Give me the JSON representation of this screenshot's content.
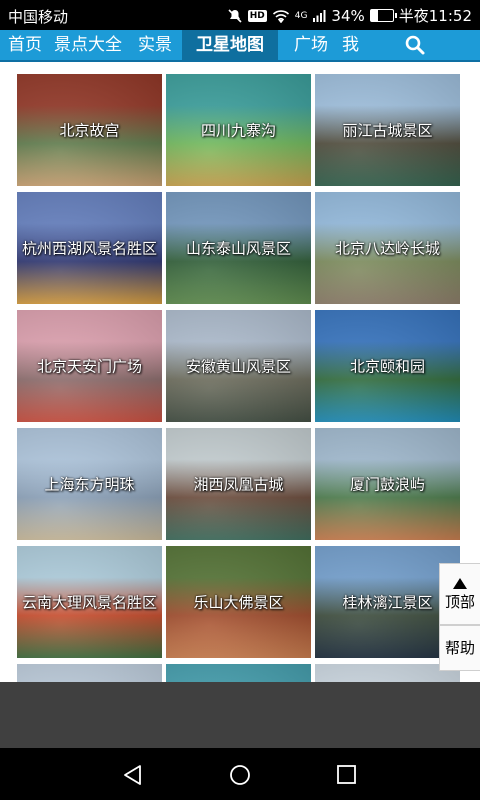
{
  "status_bar": {
    "carrier": "中国移动",
    "hd_badge": "HD",
    "network": "4G",
    "battery_percent": "34%",
    "battery_level": 0.34,
    "time": "半夜11:52"
  },
  "nav": {
    "items": [
      {
        "label": "首页"
      },
      {
        "label": "景点大全"
      },
      {
        "label": "实景"
      },
      {
        "label": "卫星地图",
        "active": true
      },
      {
        "label": "广场"
      },
      {
        "label": "我"
      }
    ],
    "accent_color": "#1d9bd7",
    "active_color": "#0f6f9f"
  },
  "grid": {
    "tiles": [
      {
        "label": "北京故宫",
        "colors": [
          "#9a3b2a",
          "#5d7a4a",
          "#c9a070"
        ]
      },
      {
        "label": "四川九寨沟",
        "colors": [
          "#3fa7a4",
          "#6fb85a",
          "#c7a04a"
        ]
      },
      {
        "label": "丽江古城景区",
        "colors": [
          "#a7c9e8",
          "#4e4a3a",
          "#2e5f4a"
        ]
      },
      {
        "label": "杭州西湖风景名胜区",
        "colors": [
          "#6a86c8",
          "#2c3470",
          "#d49a3a"
        ]
      },
      {
        "label": "山东泰山风景区",
        "colors": [
          "#7aa0c8",
          "#2e5d36",
          "#5b8a4a"
        ]
      },
      {
        "label": "北京八达岭长城",
        "colors": [
          "#9cc4e8",
          "#7a8a5a",
          "#8a7a66"
        ]
      },
      {
        "label": "北京天安门广场",
        "colors": [
          "#e8a9b8",
          "#8a6a6a",
          "#c84a3a"
        ]
      },
      {
        "label": "安徽黄山风景区",
        "colors": [
          "#b7c6d8",
          "#6a6a5a",
          "#3e4a3e"
        ]
      },
      {
        "label": "北京颐和园",
        "colors": [
          "#3a7ac8",
          "#2e6a3a",
          "#1a8ab8"
        ]
      },
      {
        "label": "上海东方明珠",
        "colors": [
          "#b8d0e8",
          "#8aa0b8",
          "#c8b898"
        ]
      },
      {
        "label": "湘西凤凰古城",
        "colors": [
          "#cfd9dc",
          "#6a4a3a",
          "#3a6a5a"
        ]
      },
      {
        "label": "厦门鼓浪屿",
        "colors": [
          "#aac4da",
          "#4a7a4a",
          "#c87a4a"
        ]
      },
      {
        "label": "云南大理风景名胜区",
        "colors": [
          "#b8d8e8",
          "#c84a2a",
          "#3a6a3a"
        ]
      },
      {
        "label": "乐山大佛景区",
        "colors": [
          "#5a7a3a",
          "#a04a2a",
          "#c87a4a"
        ]
      },
      {
        "label": "桂林漓江景区",
        "colors": [
          "#7aa8d8",
          "#3a4a3a",
          "#1a2a3a"
        ]
      },
      {
        "label": "",
        "colors": [
          "#c8d8e8",
          "#8aa8c8",
          "#6a8ab0"
        ]
      },
      {
        "label": "",
        "colors": [
          "#4aa8b8",
          "#2a8898",
          "#3a98a8"
        ]
      },
      {
        "label": "",
        "colors": [
          "#d8e4ee",
          "#8aa0b0",
          "#6a8aa0"
        ]
      }
    ]
  },
  "float_buttons": {
    "top_label": "顶部",
    "help_label": "帮助"
  }
}
